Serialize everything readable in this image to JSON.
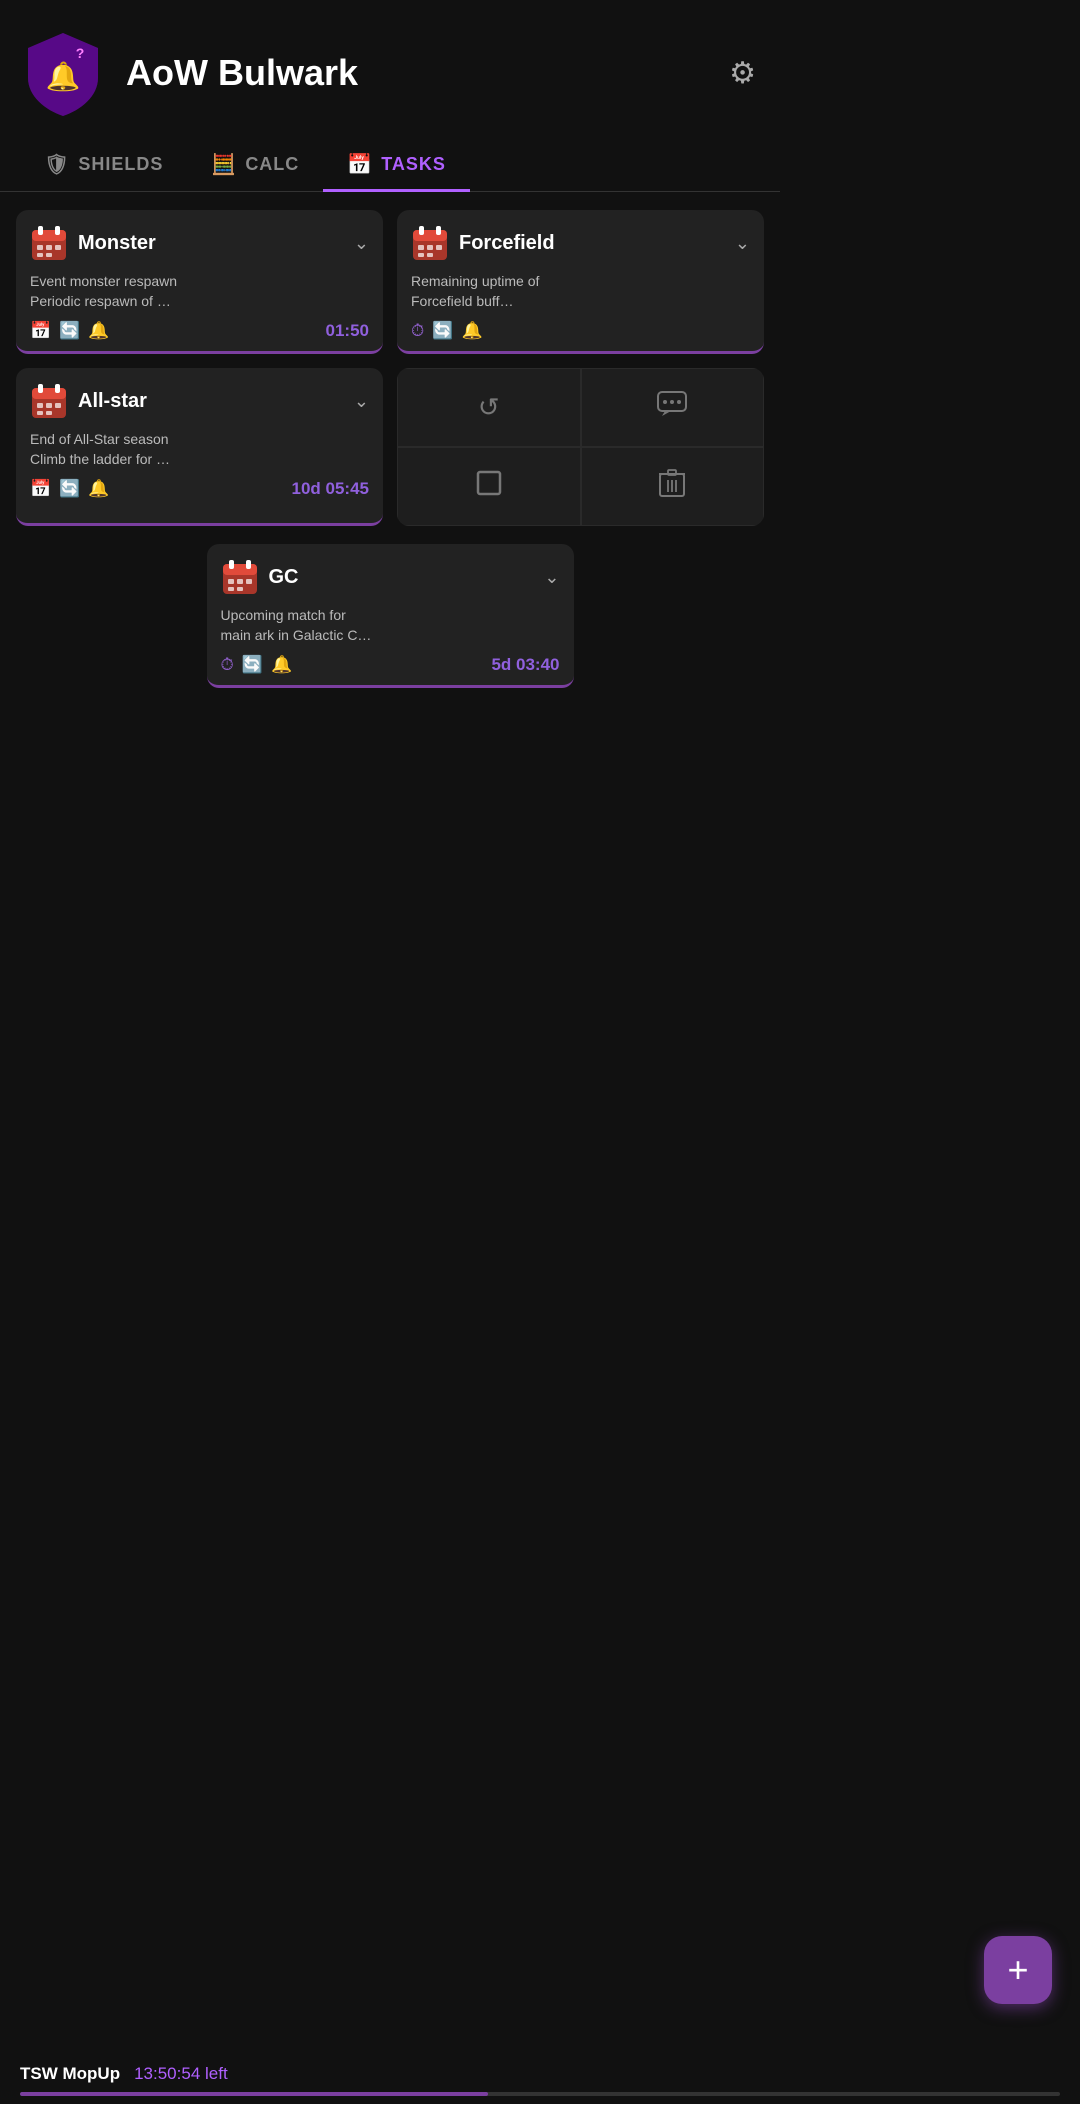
{
  "app": {
    "title": "AoW Bulwark",
    "gear_label": "⚙"
  },
  "tabs": [
    {
      "id": "shields",
      "label": "SHIELDS",
      "active": false
    },
    {
      "id": "calc",
      "label": "CALC",
      "active": false
    },
    {
      "id": "tasks",
      "label": "TASKS",
      "active": true
    }
  ],
  "tasks": [
    {
      "id": "monster",
      "title": "Monster",
      "desc": "Event monster respawn\nPeriodic respawn of …",
      "time": "01:50",
      "icons": [
        "📅",
        "🔄",
        "🔔"
      ]
    },
    {
      "id": "forcefield",
      "title": "Forcefield",
      "desc": "Remaining uptime of\nForcefield buff…",
      "time": "",
      "icons": [
        "⏱",
        "🔄",
        "🔔"
      ]
    },
    {
      "id": "allstar",
      "title": "All-star",
      "desc": "End of All-Star season\nClimb the ladder for …",
      "time": "10d  05:45",
      "icons": [
        "📅",
        "🔄",
        "🔔"
      ]
    },
    {
      "id": "gc",
      "title": "GC",
      "desc": "Upcoming match for\nmain ark in Galactic C…",
      "time": "5d  03:40",
      "icons": [
        "⏱",
        "🔄",
        "🔔"
      ]
    }
  ],
  "action_buttons": [
    {
      "id": "reset",
      "icon": "↺"
    },
    {
      "id": "comment",
      "icon": "💬"
    },
    {
      "id": "square",
      "icon": "□"
    },
    {
      "id": "trash",
      "icon": "🗑"
    }
  ],
  "fab": {
    "label": "+"
  },
  "status": {
    "name": "TSW MopUp",
    "time": "13:50:54 left",
    "progress": 45
  }
}
